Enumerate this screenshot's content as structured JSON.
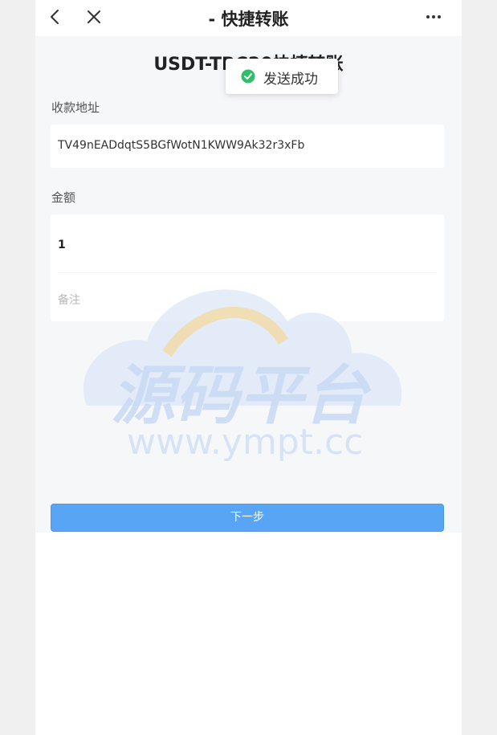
{
  "nav": {
    "title": "- 快捷转账",
    "back_icon": "chevron-left-icon",
    "close_icon": "close-icon",
    "more_icon": "more-dots-icon"
  },
  "page": {
    "title": "USDT-TRC20快捷转账"
  },
  "form": {
    "address_label": "收款地址",
    "address_value": "TV49nEADdqtS5BGfWotN1KWW9Ak32r3xFb",
    "amount_label": "金额",
    "amount_value": "1",
    "memo_placeholder": "备注",
    "next_label": "下一步"
  },
  "toast": {
    "message": "发送成功",
    "icon": "check-circle-icon"
  },
  "watermark": {
    "brand": "源码平台",
    "url": "www.ympt.cc"
  },
  "colors": {
    "primary": "#58a5f5",
    "success": "#2fbe6a",
    "background": "#f6f7f9"
  }
}
